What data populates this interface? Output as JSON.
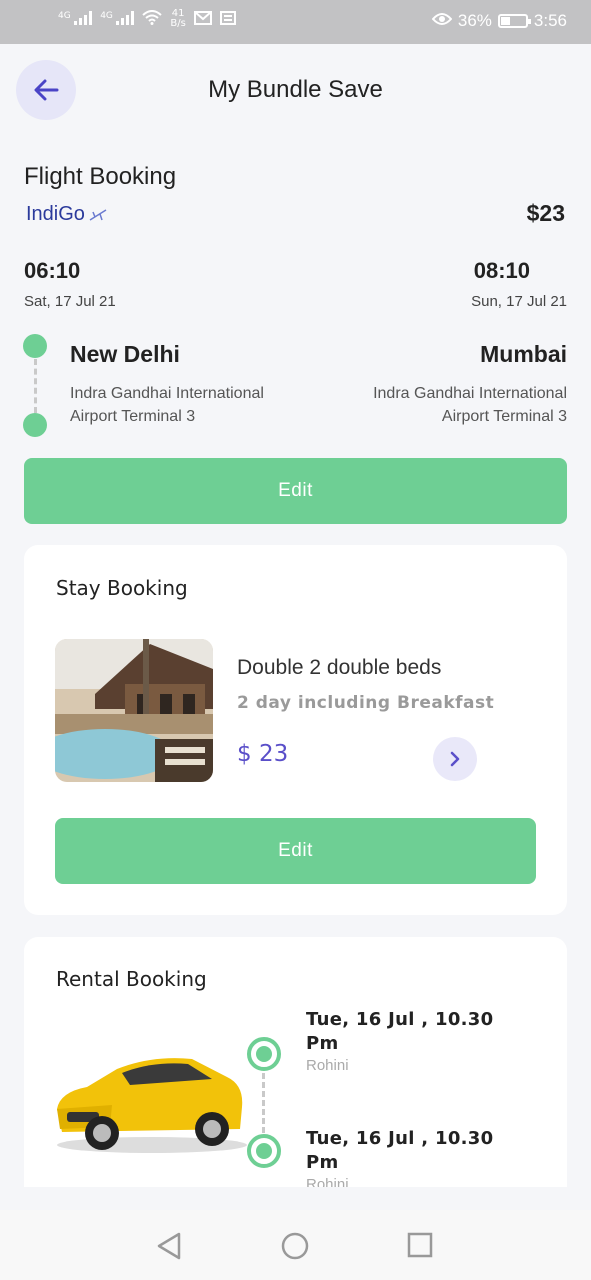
{
  "status_bar": {
    "net1": "4G",
    "net2": "4G",
    "speed_value": "41",
    "speed_unit": "B/s",
    "battery": "36%",
    "battery_level": 0.36,
    "time": "3:56"
  },
  "header": {
    "title": "My Bundle Save"
  },
  "flight": {
    "section_title": "Flight Booking",
    "airline": "IndiGo",
    "price": "$23",
    "depart_time": "06:10",
    "depart_date": "Sat, 17 Jul 21",
    "arrive_time": "08:10",
    "arrive_date": "Sun, 17 Jul 21",
    "from_city": "New Delhi",
    "from_airport_line1": "Indra Gandhai International",
    "from_airport_line2": "Airport Terminal 3",
    "to_city": "Mumbai",
    "to_airport_line1": "Indra Gandhai International",
    "to_airport_line2": "Airport Terminal 3",
    "edit_label": "Edit"
  },
  "stay": {
    "section_title": "Stay Booking",
    "room_name": "Double 2 double beds",
    "room_sub": "2 day including Breakfast",
    "price": "$ 23",
    "edit_label": "Edit"
  },
  "rental": {
    "section_title": "Rental  Booking",
    "pickup_time": "Tue, 16 Jul , 10.30 Pm",
    "pickup_location": "Rohini",
    "drop_time": "Tue, 16 Jul , 10.30 Pm",
    "drop_location": "Rohini"
  },
  "colors": {
    "accent_green": "#6ecf94",
    "accent_purple": "#5a4fc9",
    "airline_blue": "#2b3a9c"
  }
}
